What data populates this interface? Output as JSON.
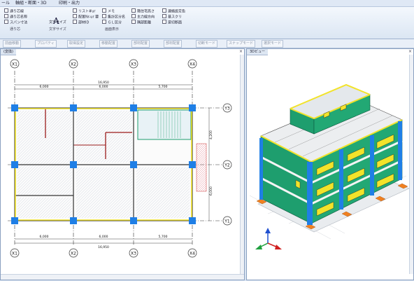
{
  "menu": {
    "items": [
      {
        "label": "ール"
      },
      {
        "label": "軸組・断面・3D"
      },
      {
        "label": "印刷・出力"
      }
    ]
  },
  "ribbon": {
    "checks": [
      {
        "label": "通り芯線"
      },
      {
        "label": "通り芯名称"
      },
      {
        "label": "スパン寸法"
      },
      {
        "label": "リスト#ur"
      },
      {
        "label": "配置Nr-ur 要"
      },
      {
        "label": "部材ID"
      },
      {
        "label": "メモ"
      },
      {
        "label": "集計区分名"
      },
      {
        "label": "ＧＬ区分"
      },
      {
        "label": "階住宅高さ"
      },
      {
        "label": "主力線方向"
      },
      {
        "label": "隅部距離"
      },
      {
        "label": "連絡設定色"
      },
      {
        "label": "基スクリ"
      },
      {
        "label": "梁切断面"
      }
    ],
    "font_button_label": "文字サイズ",
    "big_glyph": "A",
    "group_labels": [
      {
        "label": "通り芯"
      },
      {
        "label": "文字サイズ"
      },
      {
        "label": "画面表示"
      }
    ]
  },
  "toolbar": {
    "buttons": [
      {
        "label": "前面移動"
      },
      {
        "label": "プロパティ"
      },
      {
        "label": "取得設定"
      },
      {
        "label": "移動配置"
      },
      {
        "label": "部材配置"
      },
      {
        "label": "部材配置"
      },
      {
        "label": "切断モード"
      },
      {
        "label": "スナップモード"
      },
      {
        "label": "選択モード"
      }
    ]
  },
  "left_pane": {
    "tab_label": "(変換)",
    "close_glyph": "×",
    "axis_labels_top": [
      "X1",
      "X2",
      "X3",
      "X4"
    ],
    "axis_labels_bottom": [
      "X1",
      "X2",
      "X3",
      "X4"
    ],
    "axis_labels_right": [
      "Y3",
      "Y2",
      "Y1"
    ],
    "top_total_dim": "16,950",
    "bottom_total_dim": "16,950",
    "span_dims_top": [
      "6,000",
      "6,000",
      "5,700"
    ],
    "span_dims_bottom": [
      "6,000",
      "6,000",
      "5,700"
    ],
    "right_dims": [
      "4,200",
      "6,000",
      "6,000"
    ]
  },
  "right_pane": {
    "tab_label": "3Dビュー",
    "close_glyph": "×"
  },
  "colors": {
    "column": "#1f7fe6",
    "beam": "#f2e32a",
    "wall_green": "#1e9e6e",
    "footing": "#f08020",
    "grid": "#222222"
  }
}
